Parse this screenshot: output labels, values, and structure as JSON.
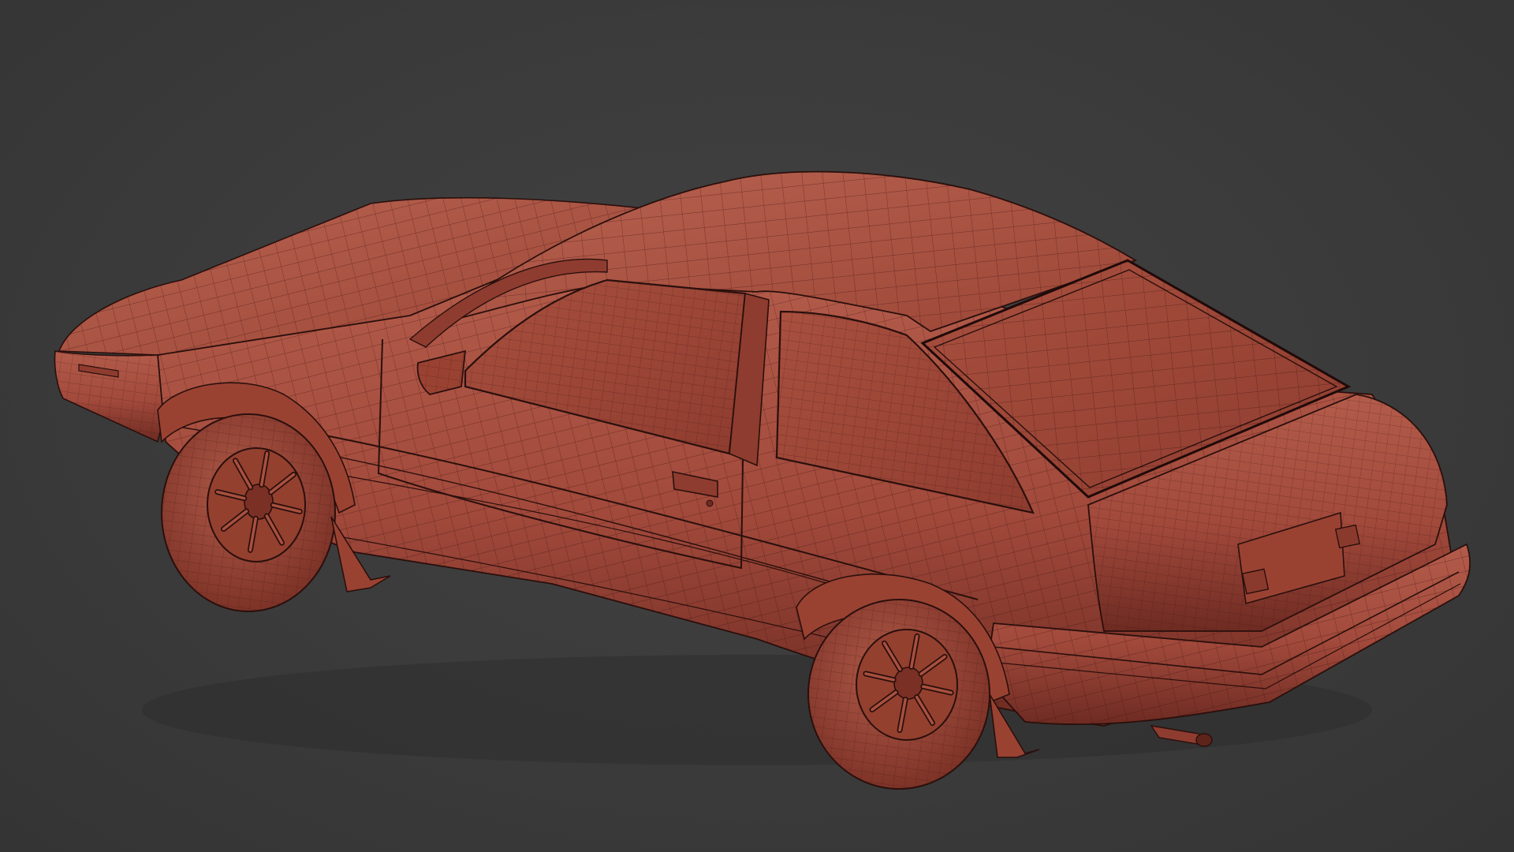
{
  "viewport": {
    "background_color": "#3b3b3b",
    "subject": "wireframe-car-model"
  },
  "model": {
    "body_color": "#a1493b",
    "body_shadow_color": "#6e2b22",
    "body_highlight_color": "#b45c4b",
    "wire_color": "#2a0f0c",
    "fine_wire_color": "#5a2219"
  }
}
